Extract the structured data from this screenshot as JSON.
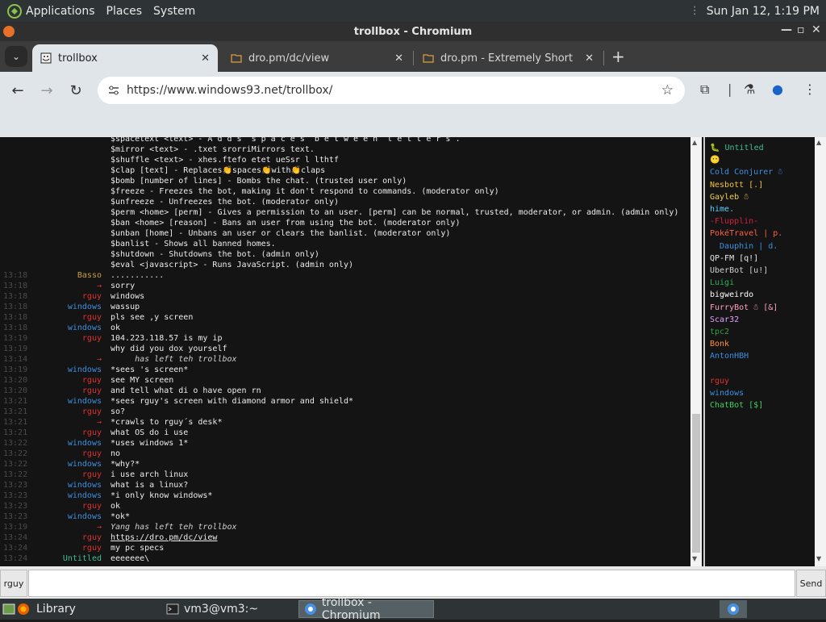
{
  "top_panel": {
    "menus": [
      "Applications",
      "Places",
      "System"
    ],
    "clock": "Sun Jan 12,  1:19 PM"
  },
  "window": {
    "title": "trollbox - Chromium"
  },
  "tabs": [
    {
      "label": "trollbox",
      "active": true
    },
    {
      "label": "dro.pm/dc/view",
      "active": false
    },
    {
      "label": "dro.pm - Extremely Short Lin",
      "active": false
    }
  ],
  "toolbar": {
    "url": "https://www.windows93.net/trollbox/"
  },
  "help_lines": [
    "$spacetext <text> - A d d s  s p a c e s  b e t w e e n  l e t t e r s .",
    "$mirror <text> - .txet srorriMirrors text.",
    "$shuffle <text> - xhes.ftefo etet ueSsr l lthtf",
    "$clap [text] - Replaces👏spaces👏with👏claps",
    "$bomb [number of lines] - Bombs the chat. (trusted user only)",
    "$freeze - Freezes the bot, making it don't respond to commands. (moderator only)",
    "$unfreeze - Unfreezes the bot. (moderator only)",
    "$perm <home> [perm] - Gives a permission to an user. [perm] can be normal, trusted, moderator, or admin. (admin only)",
    "$ban <home> [reason] - Bans an user from using the bot. (moderator only)",
    "$unban [home] - Unbans an user or clears the banlist. (moderator only)",
    "$banlist - Shows all banned homes.",
    "$shutdown - Shutdowns the bot. (admin only)",
    "$eval <javascript> - Runs JavaScript. (admin only)"
  ],
  "messages": [
    {
      "time": "13:18",
      "nick": "Basso",
      "color": "#c8a040",
      "text": "..........."
    },
    {
      "time": "13:18",
      "nick": "→",
      "color": "#e03030",
      "text": "sorry"
    },
    {
      "time": "13:18",
      "nick": "rguy",
      "color": "#e03030",
      "text": "windows"
    },
    {
      "time": "13:18",
      "nick": "windows",
      "color": "#3d8fe0",
      "text": "wassup"
    },
    {
      "time": "13:18",
      "nick": "rguy",
      "color": "#e03030",
      "text": "pls see ,y screen"
    },
    {
      "time": "13:18",
      "nick": "windows",
      "color": "#3d8fe0",
      "text": "ok"
    },
    {
      "time": "13:19",
      "nick": "rguy",
      "color": "#e03030",
      "text": "104.223.118.57 is my ip"
    },
    {
      "time": "13:19",
      "nick": "",
      "color": "#e03030",
      "text": "why did you dox yourself"
    },
    {
      "time": "13:14",
      "nick": "→",
      "color": "#e03030",
      "text": "     has left teh trollbox",
      "style": "italic"
    },
    {
      "time": "13:19",
      "nick": "windows",
      "color": "#3d8fe0",
      "text": "*sees 's screen*"
    },
    {
      "time": "13:20",
      "nick": "rguy",
      "color": "#e03030",
      "text": "see MY screen"
    },
    {
      "time": "13:20",
      "nick": "rguy",
      "color": "#e03030",
      "text": "and tell what di o have open rn"
    },
    {
      "time": "13:21",
      "nick": "windows",
      "color": "#3d8fe0",
      "text": "*sees rguy's screen with diamond armor and shield*"
    },
    {
      "time": "13:21",
      "nick": "rguy",
      "color": "#e03030",
      "text": "so?"
    },
    {
      "time": "13:21",
      "nick": "→",
      "color": "#e03030",
      "text": "*crawls to rguy´s desk*"
    },
    {
      "time": "13:21",
      "nick": "rguy",
      "color": "#e03030",
      "text": "what OS do i use"
    },
    {
      "time": "13:22",
      "nick": "windows",
      "color": "#3d8fe0",
      "text": "*uses windows 1*"
    },
    {
      "time": "13:22",
      "nick": "rguy",
      "color": "#e03030",
      "text": "no"
    },
    {
      "time": "13:22",
      "nick": "windows",
      "color": "#3d8fe0",
      "text": "*why?*"
    },
    {
      "time": "13:22",
      "nick": "rguy",
      "color": "#e03030",
      "text": "i use arch linux"
    },
    {
      "time": "13:23",
      "nick": "windows",
      "color": "#3d8fe0",
      "text": "what is a linux?"
    },
    {
      "time": "13:23",
      "nick": "windows",
      "color": "#3d8fe0",
      "text": "*i only know windows*"
    },
    {
      "time": "13:23",
      "nick": "rguy",
      "color": "#e03030",
      "text": "ok"
    },
    {
      "time": "13:23",
      "nick": "windows",
      "color": "#3d8fe0",
      "text": "*ok*"
    },
    {
      "time": "13:19",
      "nick": "→",
      "color": "#e03030",
      "text": "Yang has left teh trollbox",
      "style": "italic"
    },
    {
      "time": "13:24",
      "nick": "rguy",
      "color": "#e03030",
      "text": "https://dro.pm/dc/view",
      "style": "link"
    },
    {
      "time": "13:24",
      "nick": "rguy",
      "color": "#e03030",
      "text": "my pc specs"
    },
    {
      "time": "13:24",
      "nick": "Untitled",
      "color": "#3fbf8f",
      "text": "eeeeeee\\"
    }
  ],
  "users": [
    {
      "name": "🐛 Untitled",
      "color": "#3fbf8f"
    },
    {
      "name": "😶",
      "color": "#e8e83a"
    },
    {
      "name": "Cold Conjurer ☃",
      "color": "#3d8fe0"
    },
    {
      "name": "Nesbott [.]",
      "color": "#f0c040"
    },
    {
      "name": "Gayleb ☃",
      "color": "#f0d050"
    },
    {
      "name": "hime.",
      "color": "#5ad0ff"
    },
    {
      "name": "-Flupplin-",
      "color": "#d02040"
    },
    {
      "name": "PokéTravel | p.",
      "color": "#ff6040"
    },
    {
      "name": "  Dauphin | d.",
      "color": "#3d8fe0"
    },
    {
      "name": "QP-FM [q!]",
      "color": "#e8e8e8"
    },
    {
      "name": "UberBot [u!]",
      "color": "#d0d0d0"
    },
    {
      "name": "Luigi",
      "color": "#2fb050"
    },
    {
      "name": "bigweirdo",
      "color": "#ffffff"
    },
    {
      "name": "FurryBot ☃ [&]",
      "color": "#ffa0c0"
    },
    {
      "name": "Scar32",
      "color": "#e0a0ff"
    },
    {
      "name": "tpc2",
      "color": "#30a040"
    },
    {
      "name": "Bonk",
      "color": "#ff9040"
    },
    {
      "name": "AntonHBH",
      "color": "#3d8fe0"
    },
    {
      "name": "",
      "color": "#ffffff"
    },
    {
      "name": "rguy",
      "color": "#e03030"
    },
    {
      "name": "windows",
      "color": "#3d8fe0"
    },
    {
      "name": "ChatBot [$]",
      "color": "#3fd060"
    }
  ],
  "input": {
    "nick": "rguy",
    "send_label": "Send"
  },
  "taskbar": {
    "items": [
      "Library",
      "vm3@vm3:~",
      "trollbox - Chromium"
    ]
  }
}
